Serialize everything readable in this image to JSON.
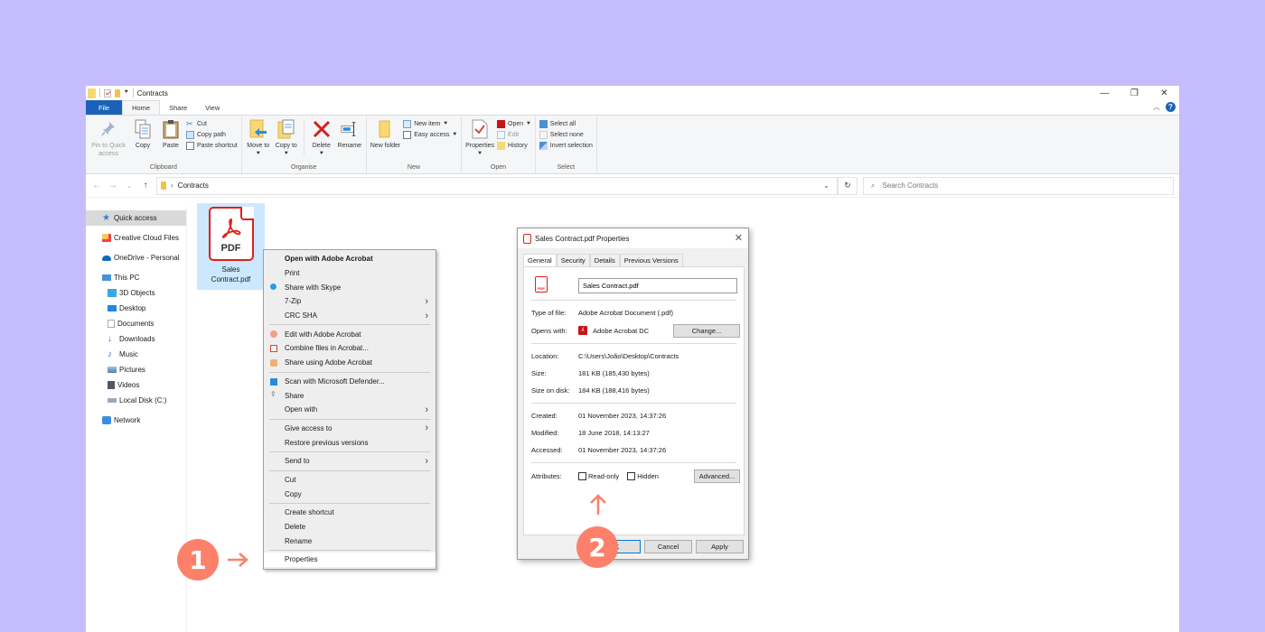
{
  "background_color": "#c5bdfd",
  "accent_color": "#fd806b",
  "window": {
    "title": "Contracts",
    "controls": {
      "minimize": "—",
      "maximize": "❐",
      "close": "✕"
    }
  },
  "ribbon_tabs": [
    "File",
    "Home",
    "Share",
    "View"
  ],
  "ribbon": {
    "clipboard": {
      "label": "Clipboard",
      "pin": "Pin to Quick access",
      "copy": "Copy",
      "paste": "Paste",
      "cut": "Cut",
      "copy_path": "Copy path",
      "paste_shortcut": "Paste shortcut"
    },
    "organise": {
      "label": "Organise",
      "move_to": "Move to",
      "copy_to": "Copy to",
      "delete": "Delete",
      "rename": "Rename"
    },
    "new": {
      "label": "New",
      "new_folder": "New folder",
      "new_item": "New item",
      "easy_access": "Easy access"
    },
    "open": {
      "label": "Open",
      "properties": "Properties",
      "open": "Open",
      "edit": "Edit",
      "history": "History"
    },
    "select": {
      "label": "Select",
      "select_all": "Select all",
      "select_none": "Select none",
      "invert": "Invert selection"
    }
  },
  "address": {
    "path": "Contracts",
    "search_placeholder": "Search Contracts"
  },
  "nav": {
    "items": [
      {
        "label": "Quick access",
        "icon": "star-icon",
        "selected": true
      },
      {
        "label": "Creative Cloud Files",
        "icon": "creative-cloud-folder-icon"
      },
      {
        "label": "OneDrive - Personal",
        "icon": "onedrive-cloud-icon"
      },
      {
        "label": "This PC",
        "icon": "computer-icon"
      },
      {
        "label": "3D Objects",
        "icon": "cube-icon"
      },
      {
        "label": "Desktop",
        "icon": "desktop-icon"
      },
      {
        "label": "Documents",
        "icon": "document-icon"
      },
      {
        "label": "Downloads",
        "icon": "download-arrow-icon"
      },
      {
        "label": "Music",
        "icon": "music-note-icon"
      },
      {
        "label": "Pictures",
        "icon": "picture-icon"
      },
      {
        "label": "Videos",
        "icon": "film-icon"
      },
      {
        "label": "Local Disk (C:)",
        "icon": "drive-icon"
      },
      {
        "label": "Network",
        "icon": "network-icon"
      }
    ]
  },
  "file": {
    "name_line1": "Sales",
    "name_line2": "Contract.pdf",
    "icon_label": "PDF"
  },
  "context_menu": {
    "items": [
      "Open with Adobe Acrobat",
      "Print",
      "Share with Skype",
      "7-Zip",
      "CRC SHA",
      "Edit with Adobe Acrobat",
      "Combine files in Acrobat...",
      "Share using Adobe Acrobat",
      "Scan with Microsoft Defender...",
      "Share",
      "Open with",
      "Give access to",
      "Restore previous versions",
      "Send to",
      "Cut",
      "Copy",
      "Create shortcut",
      "Delete",
      "Rename",
      "Properties"
    ]
  },
  "properties": {
    "title": "Sales Contract.pdf Properties",
    "tabs": [
      "General",
      "Security",
      "Details",
      "Previous Versions"
    ],
    "filename": "Sales Contract.pdf",
    "type_label": "Type of file:",
    "type_value": "Adobe Acrobat Document (.pdf)",
    "opens_label": "Opens with:",
    "opens_value": "Adobe Acrobat DC",
    "change_button": "Change...",
    "location_label": "Location:",
    "location_value": "C:\\Users\\João\\Desktop\\Contracts",
    "size_label": "Size:",
    "size_value": "181 KB (185,430 bytes)",
    "disk_label": "Size on disk:",
    "disk_value": "184 KB (188,416 bytes)",
    "created_label": "Created:",
    "created_value": "01 November 2023, 14:37:26",
    "modified_label": "Modified:",
    "modified_value": "18 June 2018, 14:13:27",
    "accessed_label": "Accessed:",
    "accessed_value": "01 November 2023, 14:37:26",
    "attributes_label": "Attributes:",
    "readonly_label": "Read-only",
    "readonly_checked": false,
    "hidden_label": "Hidden",
    "hidden_checked": false,
    "advanced_button": "Advanced...",
    "ok_button": "OK",
    "cancel_button": "Cancel",
    "apply_button": "Apply"
  },
  "annotations": {
    "step1": "1",
    "step2": "2"
  }
}
